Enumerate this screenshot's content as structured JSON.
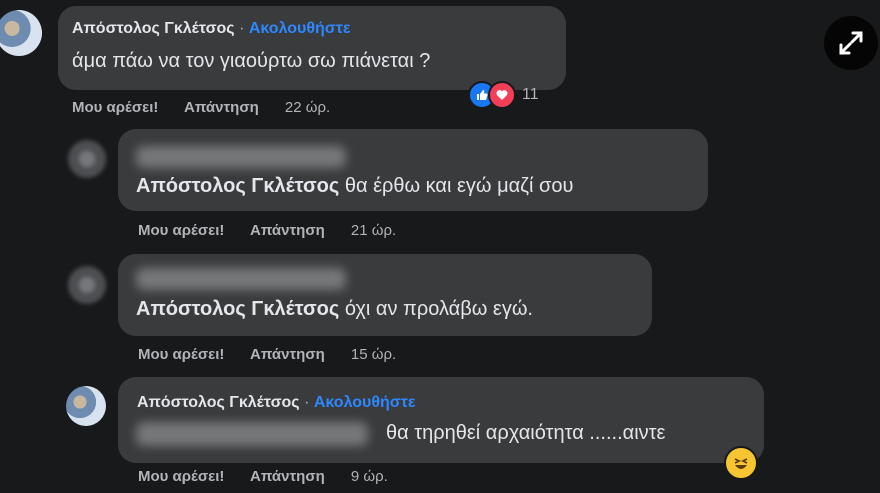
{
  "comments": [
    {
      "author": "Απόστολος Γκλέτσος",
      "separator": "·",
      "follow": "Ακολουθήστε",
      "text": "άμα πάω να τον γιαούρτω σω πιάνεται ?",
      "like": "Μου αρέσει!",
      "reply": "Απάντηση",
      "time": "22 ώρ.",
      "reaction_count": "11",
      "reaction_icons": [
        "like-icon",
        "love-icon"
      ]
    },
    {
      "mention": "Απόστολος Γκλέτσος",
      "text": "θα έρθω και εγώ μαζί σου",
      "like": "Μου αρέσει!",
      "reply": "Απάντηση",
      "time": "21 ώρ."
    },
    {
      "mention": "Απόστολος Γκλέτσος",
      "text": "όχι αν προλάβω εγώ.",
      "like": "Μου αρέσει!",
      "reply": "Απάντηση",
      "time": "15 ώρ."
    },
    {
      "author": "Απόστολος Γκλέτσος",
      "separator": "·",
      "follow": "Ακολουθήστε",
      "text": "θα τηρηθεί αρχαιότητα ......αιντε",
      "like": "Μου αρέσει!",
      "reply": "Απάντηση",
      "time": "9 ώρ.",
      "emoji_icon": "grinning-squinting-face-icon"
    }
  ],
  "expand_icon": "expand-arrows-icon",
  "colors": {
    "background": "#18191a",
    "bubble": "#3a3b3c",
    "link": "#2d88ff"
  }
}
